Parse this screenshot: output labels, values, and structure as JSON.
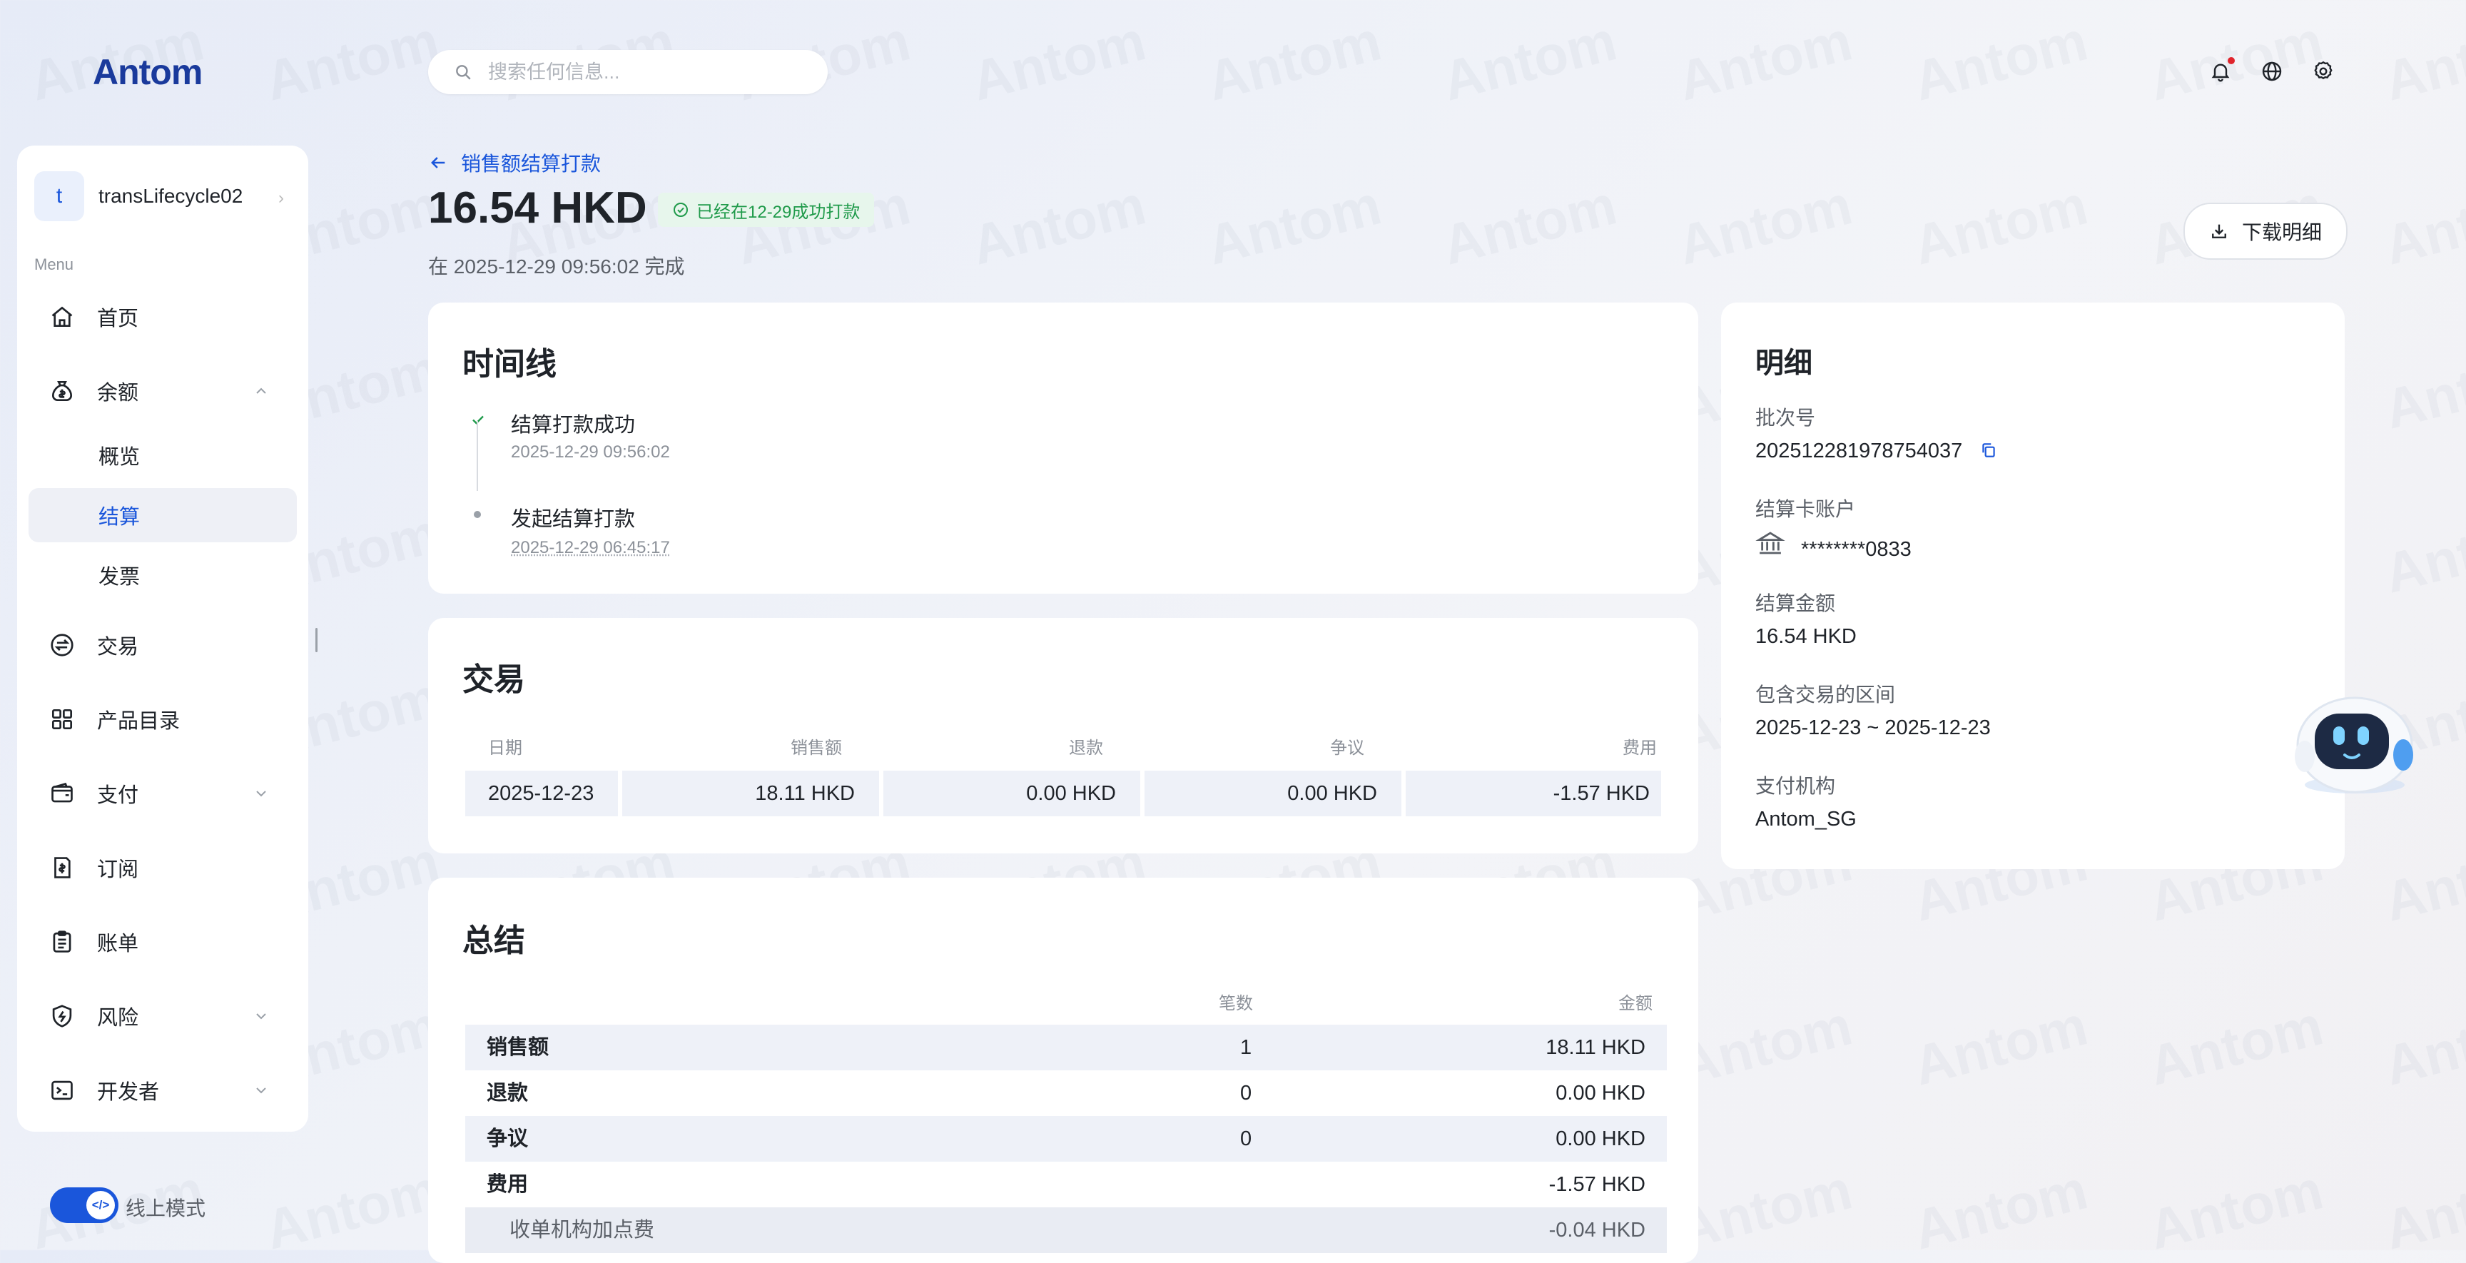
{
  "logo_text": "Antom",
  "search": {
    "placeholder": "搜索任何信息..."
  },
  "sidebar": {
    "account_initial": "t",
    "account_name": "transLifecycle02",
    "menu_caption": "Menu",
    "items": [
      {
        "label": "首页"
      },
      {
        "label": "余额"
      },
      {
        "label": "交易"
      },
      {
        "label": "产品目录"
      },
      {
        "label": "支付"
      },
      {
        "label": "订阅"
      },
      {
        "label": "账单"
      },
      {
        "label": "风险"
      },
      {
        "label": "开发者"
      }
    ],
    "balance_sub": [
      {
        "label": "概览"
      },
      {
        "label": "结算"
      },
      {
        "label": "发票"
      }
    ]
  },
  "mode": {
    "label": "线上模式",
    "toggle_glyph": "</>"
  },
  "header": {
    "back_label": "销售额结算打款",
    "amount": "16.54 HKD",
    "status_badge": "已经在12-29成功打款",
    "completed_text": "在 2025-12-29 09:56:02 完成",
    "download_label": "下载明细"
  },
  "timeline": {
    "title": "时间线",
    "events": [
      {
        "title": "结算打款成功",
        "time": "2025-12-29 09:56:02"
      },
      {
        "title": "发起结算打款",
        "time": "2025-12-29 06:45:17"
      }
    ]
  },
  "transactions": {
    "title": "交易",
    "headers": [
      "日期",
      "销售额",
      "退款",
      "争议",
      "费用"
    ],
    "rows": [
      [
        "2025-12-23",
        "18.11 HKD",
        "0.00 HKD",
        "0.00 HKD",
        "-1.57 HKD"
      ]
    ]
  },
  "summary": {
    "title": "总结",
    "headers": [
      "笔数",
      "金额"
    ],
    "rows": [
      {
        "label": "销售额",
        "count": "1",
        "amount": "18.11 HKD"
      },
      {
        "label": "退款",
        "count": "0",
        "amount": "0.00 HKD"
      },
      {
        "label": "争议",
        "count": "0",
        "amount": "0.00 HKD"
      },
      {
        "label": "费用",
        "count": "",
        "amount": "-1.57 HKD"
      },
      {
        "label": "收单机构加点费",
        "count": "",
        "amount": "-0.04 HKD"
      }
    ]
  },
  "details": {
    "title": "明细",
    "batch_label": "批次号",
    "batch_value": "202512281978754037",
    "card_label": "结算卡账户",
    "card_value": "********0833",
    "amount_label": "结算金额",
    "amount_value": "16.54 HKD",
    "range_label": "包含交易的区间",
    "range_value": "2025-12-23 ~ 2025-12-23",
    "institution_label": "支付机构",
    "institution_value": "Antom_SG"
  },
  "colors": {
    "accent": "#1a56db",
    "success": "#1f9a4a",
    "alert": "#e0242c"
  }
}
